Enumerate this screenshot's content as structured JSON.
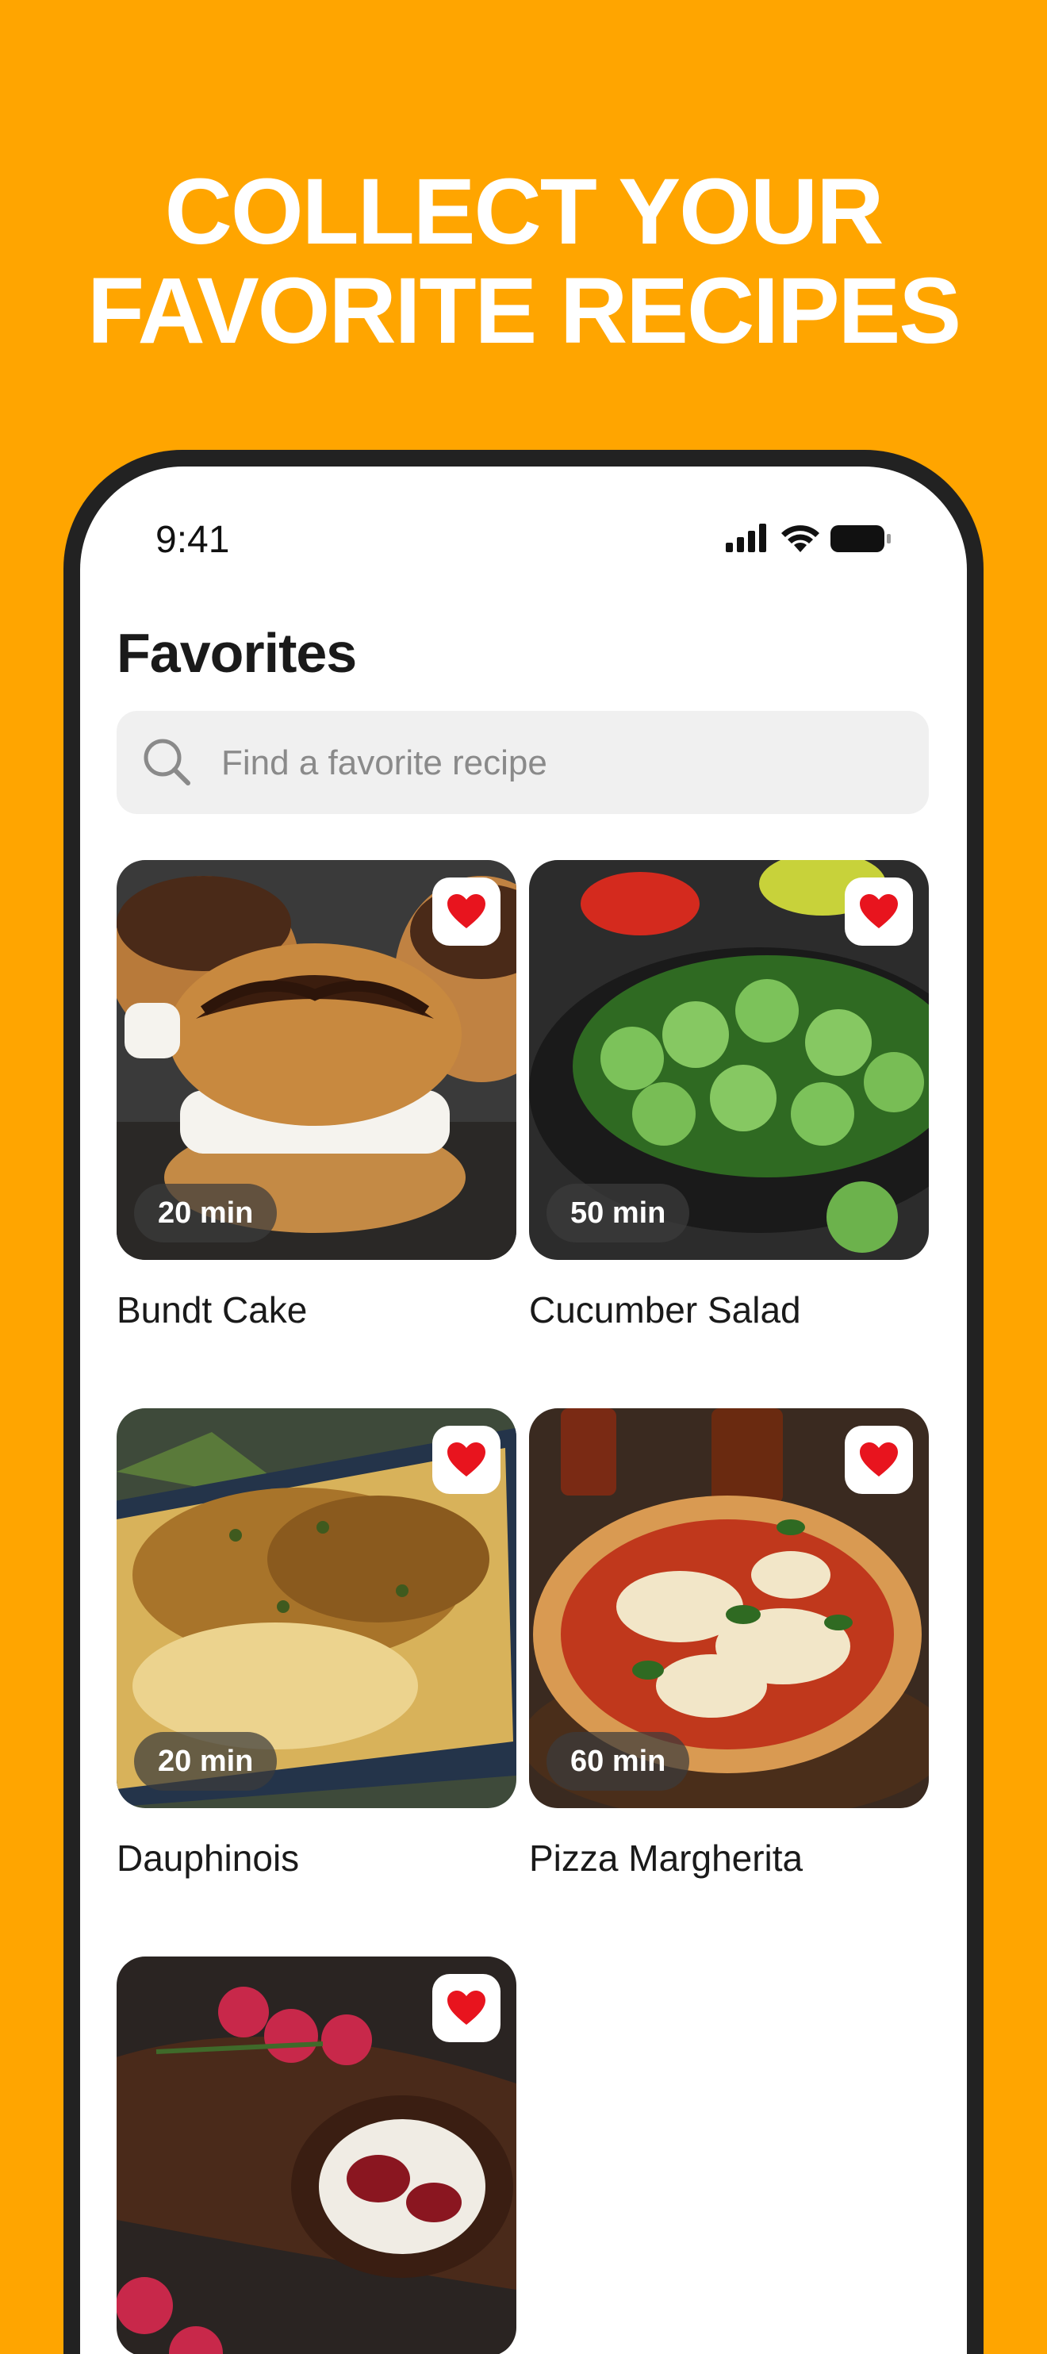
{
  "headline": {
    "line1": "COLLECT YOUR",
    "line2": "FAVORITE RECIPES"
  },
  "status_bar": {
    "time": "9:41"
  },
  "page": {
    "title": "Favorites"
  },
  "search": {
    "placeholder": "Find a favorite recipe"
  },
  "colors": {
    "background": "#FFA500",
    "heart": "#E8141E",
    "phone_frame": "#222222"
  },
  "recipes": [
    {
      "title": "Bundt Cake",
      "time": "20 min",
      "favorite": true,
      "image": "cream-puffs"
    },
    {
      "title": "Cucumber Salad",
      "time": "50 min",
      "favorite": true,
      "image": "cucumber-salad"
    },
    {
      "title": "Dauphinois",
      "time": "20 min",
      "favorite": true,
      "image": "potato-gratin"
    },
    {
      "title": "Pizza Margherita",
      "time": "60 min",
      "favorite": true,
      "image": "pizza"
    },
    {
      "title": "",
      "time": "",
      "favorite": true,
      "image": "yule-log"
    }
  ]
}
